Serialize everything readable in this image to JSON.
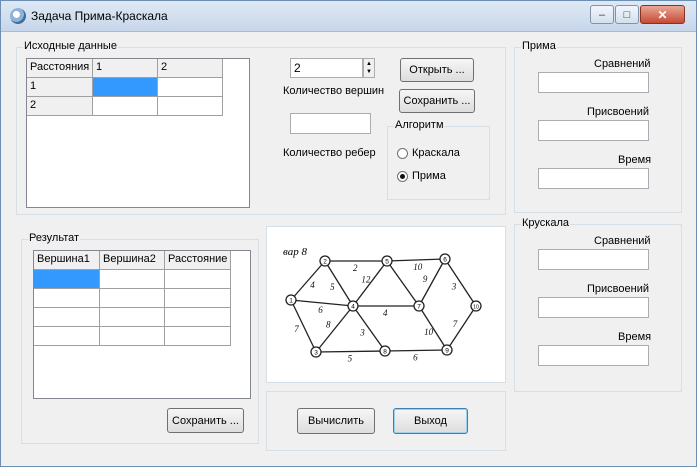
{
  "window": {
    "title": "Задача Прима-Краскала",
    "minimize_glyph": "–",
    "maximize_glyph": "□",
    "close_glyph": "✕",
    "icon": "app-globe-icon"
  },
  "input_group": {
    "label": "Исходные данные",
    "grid": {
      "headers": [
        "Расстояния",
        "1",
        "2"
      ],
      "rows": [
        {
          "label": "1",
          "cells": [
            "",
            ""
          ]
        },
        {
          "label": "2",
          "cells": [
            "",
            ""
          ]
        }
      ],
      "selected_cell": "row 1, column 1"
    },
    "vertex_count_value": "2",
    "vertex_count_label": "Количество вершин",
    "edge_count_value": "",
    "edge_count_label": "Количество ребер",
    "open_button": "Открыть ...",
    "save_button": "Сохранить ...",
    "algorithm": {
      "label": "Алгоритм",
      "options": [
        "Краскала",
        "Прима"
      ],
      "selected": "Прима"
    }
  },
  "prim_group": {
    "label": "Прима",
    "comparisons_label": "Сравнений",
    "comparisons_value": "",
    "assignments_label": "Присвоений",
    "assignments_value": "",
    "time_label": "Время",
    "time_value": ""
  },
  "kruskal_group": {
    "label": "Крускала",
    "comparisons_label": "Сравнений",
    "comparisons_value": "",
    "assignments_label": "Присвоений",
    "assignments_value": "",
    "time_label": "Время",
    "time_value": ""
  },
  "result_group": {
    "label": "Результат",
    "headers": [
      "Вершина1",
      "Вершина2",
      "Расстояние"
    ],
    "rows": [
      [
        "",
        "",
        ""
      ],
      [
        "",
        "",
        ""
      ],
      [
        "",
        "",
        ""
      ],
      [
        "",
        "",
        ""
      ]
    ],
    "save_button": "Сохранить ..."
  },
  "graph_sketch": {
    "caption": "вар 8",
    "nodes": [
      "1",
      "2",
      "3",
      "4",
      "5",
      "6",
      "7",
      "8",
      "9",
      "10"
    ],
    "edges": [
      {
        "from": "1",
        "to": "2",
        "weight": "4"
      },
      {
        "from": "1",
        "to": "4",
        "weight": "6"
      },
      {
        "from": "1",
        "to": "3",
        "weight": "7"
      },
      {
        "from": "2",
        "to": "5",
        "weight": "2"
      },
      {
        "from": "2",
        "to": "4",
        "weight": "5"
      },
      {
        "from": "5",
        "to": "4",
        "weight": "12"
      },
      {
        "from": "5",
        "to": "6",
        "weight": "10"
      },
      {
        "from": "5",
        "to": "7",
        "weight": ""
      },
      {
        "from": "6",
        "to": "7",
        "weight": "9"
      },
      {
        "from": "6",
        "to": "10",
        "weight": "3"
      },
      {
        "from": "4",
        "to": "7",
        "weight": "4"
      },
      {
        "from": "4",
        "to": "3",
        "weight": "8"
      },
      {
        "from": "4",
        "to": "8",
        "weight": "3"
      },
      {
        "from": "3",
        "to": "8",
        "weight": "5"
      },
      {
        "from": "8",
        "to": "9",
        "weight": "6"
      },
      {
        "from": "7",
        "to": "9",
        "weight": "10"
      },
      {
        "from": "10",
        "to": "9",
        "weight": "7"
      }
    ]
  },
  "actions": {
    "calculate_button": "Вычислить",
    "exit_button": "Выход"
  }
}
